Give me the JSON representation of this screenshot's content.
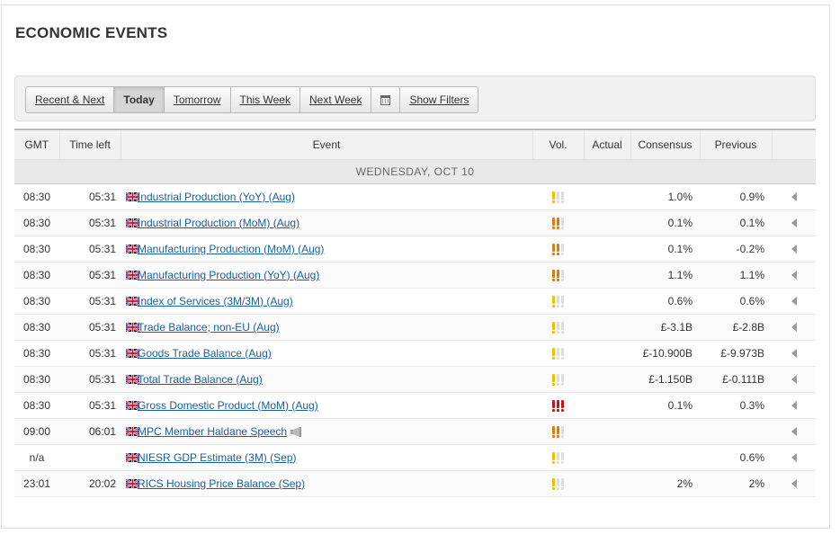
{
  "page": {
    "title": "ECONOMIC EVENTS"
  },
  "toolbar": {
    "buttons": [
      {
        "label": "Recent & Next",
        "active": false
      },
      {
        "label": "Today",
        "active": true
      },
      {
        "label": "Tomorrow",
        "active": false
      },
      {
        "label": "This Week",
        "active": false
      },
      {
        "label": "Next Week",
        "active": false
      }
    ],
    "calendar_icon": "calendar-icon",
    "show_filters_label": "Show Filters"
  },
  "table": {
    "headers": {
      "gmt": "GMT",
      "time_left": "Time left",
      "event": "Event",
      "vol": "Vol.",
      "actual": "Actual",
      "consensus": "Consensus",
      "previous": "Previous"
    },
    "date_label": "WEDNESDAY, OCT 10",
    "volatility_colors": {
      "low": "#f0c000",
      "medium": "#e07a10",
      "high": "#c01818",
      "inactive": "#dddddd"
    },
    "rows": [
      {
        "gmt": "08:30",
        "time_left": "05:31",
        "event": "Industrial Production (YoY) (Aug)",
        "vol": 1,
        "actual": "",
        "consensus": "1.0%",
        "previous": "0.9%",
        "speech": false
      },
      {
        "gmt": "08:30",
        "time_left": "05:31",
        "event": "Industrial Production (MoM) (Aug)",
        "vol": 2,
        "actual": "",
        "consensus": "0.1%",
        "previous": "0.1%",
        "speech": false
      },
      {
        "gmt": "08:30",
        "time_left": "05:31",
        "event": "Manufacturing Production (MoM) (Aug)",
        "vol": 2,
        "actual": "",
        "consensus": "0.1%",
        "previous": "-0.2%",
        "speech": false
      },
      {
        "gmt": "08:30",
        "time_left": "05:31",
        "event": "Manufacturing Production (YoY) (Aug)",
        "vol": 2,
        "actual": "",
        "consensus": "1.1%",
        "previous": "1.1%",
        "speech": false
      },
      {
        "gmt": "08:30",
        "time_left": "05:31",
        "event": "Index of Services (3M/3M) (Aug)",
        "vol": 1,
        "actual": "",
        "consensus": "0.6%",
        "previous": "0.6%",
        "speech": false
      },
      {
        "gmt": "08:30",
        "time_left": "05:31",
        "event": "Trade Balance; non-EU (Aug)",
        "vol": 1,
        "actual": "",
        "consensus": "£-3.1B",
        "previous": "£-2.8B",
        "speech": false
      },
      {
        "gmt": "08:30",
        "time_left": "05:31",
        "event": "Goods Trade Balance (Aug)",
        "vol": 1,
        "actual": "",
        "consensus": "£-10.900B",
        "previous": "£-9.973B",
        "speech": false
      },
      {
        "gmt": "08:30",
        "time_left": "05:31",
        "event": "Total Trade Balance (Aug)",
        "vol": 1,
        "actual": "",
        "consensus": "£-1.150B",
        "previous": "£-0.111B",
        "speech": false
      },
      {
        "gmt": "08:30",
        "time_left": "05:31",
        "event": "Gross Domestic Product (MoM) (Aug)",
        "vol": 3,
        "actual": "",
        "consensus": "0.1%",
        "previous": "0.3%",
        "speech": false
      },
      {
        "gmt": "09:00",
        "time_left": "06:01",
        "event": "MPC Member Haldane Speech",
        "vol": 2,
        "actual": "",
        "consensus": "",
        "previous": "",
        "speech": true
      },
      {
        "gmt": "n/a",
        "time_left": "",
        "event": "NIESR GDP Estimate (3M) (Sep)",
        "vol": 1,
        "actual": "",
        "consensus": "",
        "previous": "0.6%",
        "speech": false
      },
      {
        "gmt": "23:01",
        "time_left": "20:02",
        "event": "RICS Housing Price Balance (Sep)",
        "vol": 1,
        "actual": "",
        "consensus": "2%",
        "previous": "2%",
        "speech": false
      }
    ]
  }
}
